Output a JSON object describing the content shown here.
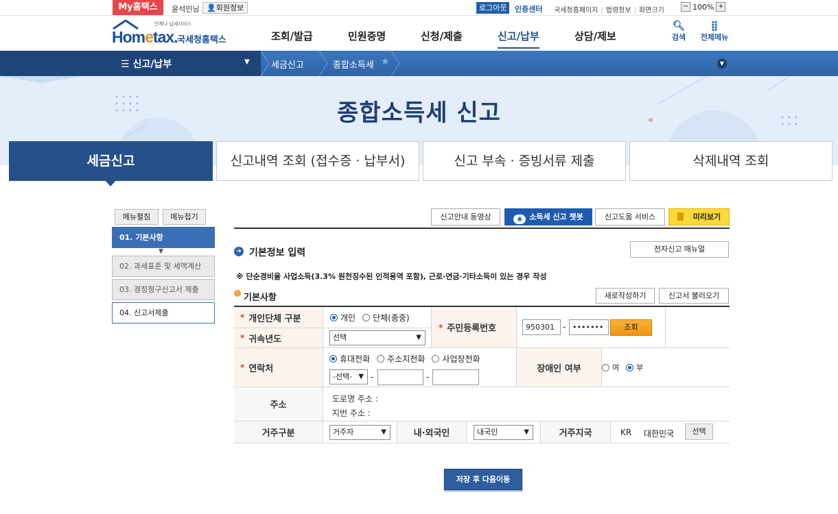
{
  "util": {
    "my_hometax": "My홈택스",
    "user": "윤석민님",
    "member_info": "회원정보",
    "logout": "로그아웃",
    "cert_center": "인증센터",
    "links": [
      "국세청홈페이지",
      "법령정보",
      "화면크기"
    ],
    "zoom": "100%"
  },
  "header": {
    "logo_small": "언제나 납세서비스",
    "logo_home": "Hom",
    "logo_e": "e",
    "logo_tax": "tax.",
    "logo_kr": "국세청홈택스",
    "nav": [
      "조회/발급",
      "민원증명",
      "신청/제출",
      "신고/납부",
      "상담/제보"
    ],
    "search": "검색",
    "all_menu": "전체메뉴"
  },
  "breadcrumb": {
    "menu": "신고/납부",
    "items": [
      "세금신고",
      "종합소득세"
    ]
  },
  "hero": {
    "title": "종합소득세 신고"
  },
  "tabs": [
    "세금신고",
    "신고내역 조회 (접수증 · 납부서)",
    "신고 부속 · 증빙서류 제출",
    "삭제내역 조회"
  ],
  "left": {
    "expand": "메뉴펼침",
    "collapse": "메뉴접기",
    "steps": [
      "01. 기본사항",
      "02. 과세표준 및 세액계산",
      "03. 경정청구신고서 제출",
      "04. 신고서제출"
    ]
  },
  "toolbar": {
    "video": "신고안내 동영상",
    "chatbot": "소득세 신고 챗봇",
    "help": "신고도움 서비스",
    "preview": "미리보기"
  },
  "section": {
    "title": "기본정보 입력",
    "manual": "전자신고 매뉴얼",
    "note": "※ 단순경비율 사업소득(3.3% 원천징수된 인적용역 포함), 근로·연금·기타소득이 있는 경우 작성",
    "sub": "기본사항",
    "new_btn": "새로작성하기",
    "load_btn": "신고서 불러오기"
  },
  "form": {
    "type_label": "개인단체 구분",
    "type_opts": [
      "개인",
      "단체(종중)"
    ],
    "year_label": "귀속년도",
    "year_value": "선택",
    "rrn_label": "주민등록번호",
    "rrn_front": "950301",
    "rrn_dash": "-",
    "rrn_back": "•••••••",
    "lookup": "조회",
    "contact_label": "연락처",
    "contact_opts": [
      "휴대전화",
      "주소지전화",
      "사업장전화"
    ],
    "phone_sel": "-선택-",
    "dash": "-",
    "disabled_label": "장애인 여부",
    "disabled_opts": [
      "여",
      "부"
    ],
    "addr_label": "주소",
    "road_addr": "도로명 주소 :",
    "lot_addr": "지번 주소 :",
    "residence_label": "거주구분",
    "residence_value": "거주자",
    "nationality_label": "내·외국인",
    "nationality_value": "내국인",
    "country_label": "거주지국",
    "country_code": "KR",
    "country_name": "대한민국",
    "country_btn": "선택"
  },
  "save_next": "저장 후 다음이동"
}
